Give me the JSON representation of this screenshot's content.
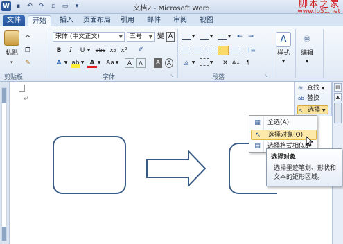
{
  "window": {
    "title": "文档2 - Microsoft Word",
    "app_icon": "W",
    "watermark_line1": "脚本之家",
    "watermark_line2": "www.Jb51.net"
  },
  "tabs": [
    "文件",
    "开始",
    "插入",
    "页面布局",
    "引用",
    "邮件",
    "审阅",
    "视图"
  ],
  "ribbon": {
    "clipboard": {
      "paste_label": "粘贴",
      "group_label": "剪贴板"
    },
    "font": {
      "font_name": "宋体 (中文正文)",
      "font_size": "五号",
      "group_label": "字体",
      "buttons": [
        "B",
        "I",
        "U",
        "abc",
        "x₂",
        "x²",
        "Aa",
        "A",
        "A",
        "A",
        "A"
      ]
    },
    "paragraph": {
      "group_label": "段落"
    },
    "styles": {
      "label": "样式"
    },
    "editing": {
      "label": "编辑"
    }
  },
  "editing_pane": {
    "find": "查找",
    "replace": "替换",
    "select": "选择"
  },
  "select_menu": {
    "items": [
      "全选(A)",
      "选择对象(O)",
      "选择格式相似的文本(S)"
    ],
    "hover_index": 1
  },
  "tooltip": {
    "title": "选择对象",
    "body": "选择墨迹笔划、形状和文本的矩形区域。"
  },
  "colors": {
    "shape_stroke": "#3a5b86",
    "accent_blue": "#2b5797",
    "watermark_red": "#d01919",
    "hover_yellow": "#fde9a9"
  }
}
